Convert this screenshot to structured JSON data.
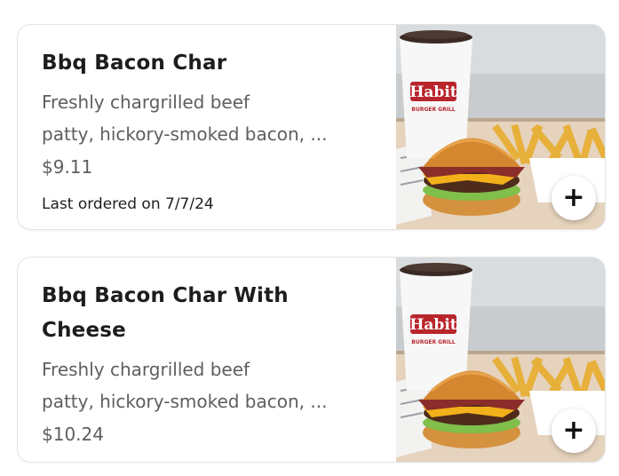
{
  "items": [
    {
      "title": "Bbq Bacon Char",
      "description_line1": "Freshly chargrilled beef",
      "description_line2": "patty, hickory-smoked bacon, ...",
      "price": "$9.11",
      "last_ordered": "Last ordered on 7/7/24",
      "image_icon": "burger-fries-drink-photo",
      "add_icon": "+"
    },
    {
      "title_line1": "Bbq Bacon Char With",
      "title_line2": "Cheese",
      "description_line1": "Freshly chargrilled beef",
      "description_line2": "patty, hickory-smoked bacon, ...",
      "price": "$10.24",
      "image_icon": "burger-fries-drink-photo",
      "add_icon": "+"
    }
  ],
  "cup_brand": "Habit",
  "cup_sub": "BURGER GRILL",
  "colors": {
    "title": "#1d1d1d",
    "secondary": "#5e5e5e",
    "card_border": "#e4e4e4"
  }
}
